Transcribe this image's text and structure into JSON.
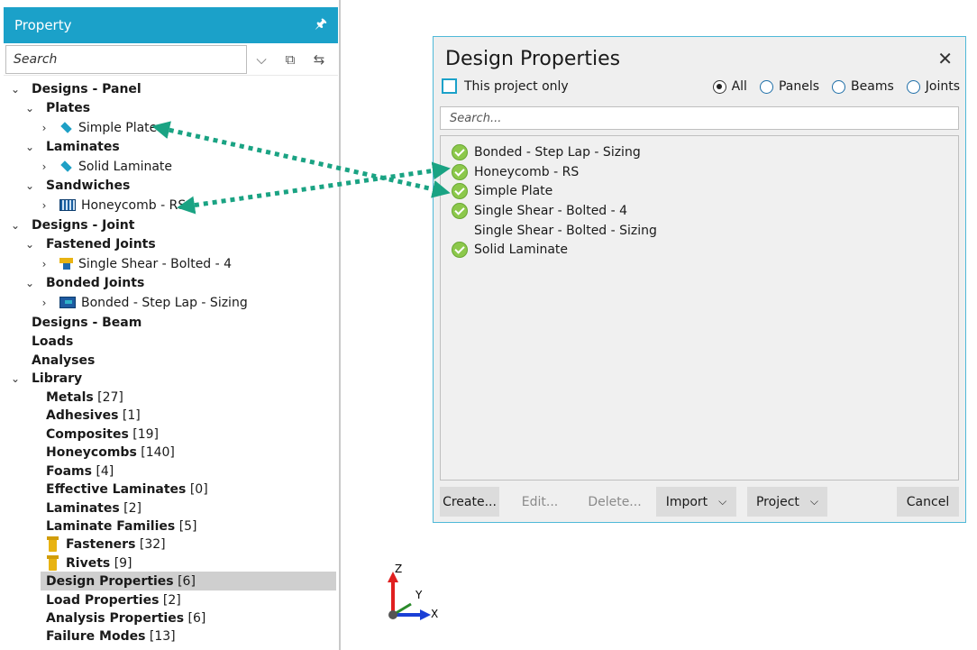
{
  "panel": {
    "title": "Property",
    "search_placeholder": "Search",
    "tree": [
      {
        "label": "Designs - Panel",
        "bold": true
      },
      {
        "label": "Plates",
        "bold": true
      },
      {
        "label": "Simple Plate",
        "icon": "diamond"
      },
      {
        "label": "Laminates",
        "bold": true
      },
      {
        "label": "Solid Laminate",
        "icon": "diamond"
      },
      {
        "label": "Sandwiches",
        "bold": true
      },
      {
        "label": "Honeycomb - RS",
        "icon": "honeycomb"
      },
      {
        "label": "Designs - Joint",
        "bold": true
      },
      {
        "label": "Fastened Joints",
        "bold": true
      },
      {
        "label": "Single Shear - Bolted - 4",
        "icon": "joint"
      },
      {
        "label": "Bonded Joints",
        "bold": true
      },
      {
        "label": "Bonded - Step Lap - Sizing",
        "icon": "bonded"
      },
      {
        "label": "Designs - Beam",
        "bold": true
      },
      {
        "label": "Loads",
        "bold": true
      },
      {
        "label": "Analyses",
        "bold": true
      },
      {
        "label": "Library",
        "bold": true
      },
      {
        "label": "Metals",
        "count": "[27]"
      },
      {
        "label": "Adhesives",
        "count": "[1]"
      },
      {
        "label": "Composites",
        "count": "[19]"
      },
      {
        "label": "Honeycombs",
        "count": "[140]"
      },
      {
        "label": "Foams",
        "count": "[4]"
      },
      {
        "label": "Effective Laminates",
        "count": "[0]"
      },
      {
        "label": "Laminates",
        "count": "[2]"
      },
      {
        "label": "Laminate Families",
        "count": "[5]"
      },
      {
        "label": "Fasteners",
        "count": "[32]",
        "icon": "bolt"
      },
      {
        "label": "Rivets",
        "count": "[9]",
        "icon": "bolt"
      },
      {
        "label": "Design Properties",
        "count": "[6]",
        "selected": true
      },
      {
        "label": "Load Properties",
        "count": "[2]"
      },
      {
        "label": "Analysis Properties",
        "count": "[6]"
      },
      {
        "label": "Failure Modes",
        "count": "[13]"
      }
    ]
  },
  "dialog": {
    "title": "Design Properties",
    "project_only_label": "This project only",
    "filters": [
      {
        "label": "All",
        "selected": true
      },
      {
        "label": "Panels",
        "selected": false
      },
      {
        "label": "Beams",
        "selected": false
      },
      {
        "label": "Joints",
        "selected": false
      }
    ],
    "search_placeholder": "Search...",
    "items": [
      {
        "label": "Bonded - Step Lap - Sizing",
        "status": "ok"
      },
      {
        "label": "Honeycomb - RS",
        "status": "ok"
      },
      {
        "label": "Simple Plate",
        "status": "ok"
      },
      {
        "label": "Single Shear - Bolted - 4",
        "status": "ok"
      },
      {
        "label": "Single Shear - Bolted - Sizing",
        "status": "none"
      },
      {
        "label": "Solid Laminate",
        "status": "ok"
      }
    ],
    "buttons": {
      "create": "Create...",
      "edit": "Edit...",
      "delete": "Delete...",
      "import": "Import",
      "project": "Project",
      "cancel": "Cancel"
    }
  },
  "axes": {
    "z": "Z",
    "y": "Y",
    "x": "X"
  },
  "colors": {
    "accent": "#1ba1c9",
    "arrow": "#1aa383",
    "ok": "#8cc84b"
  }
}
